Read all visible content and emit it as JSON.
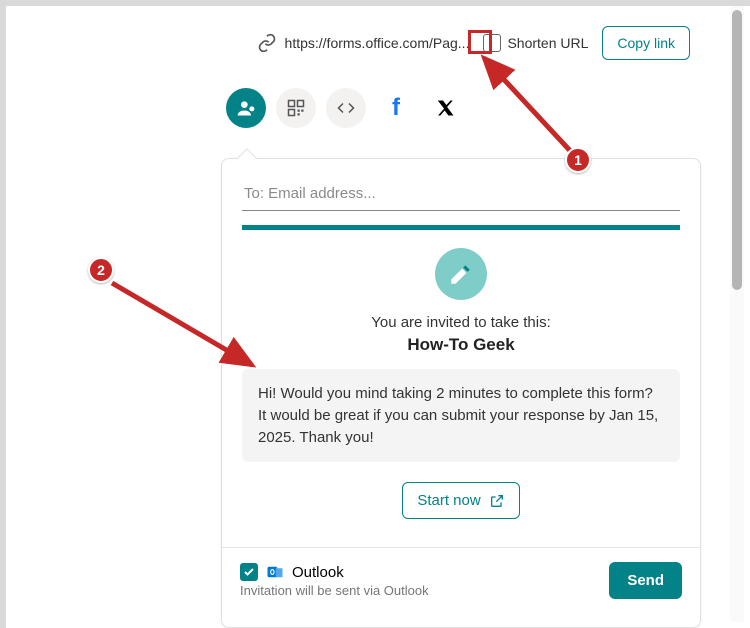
{
  "url_row": {
    "url_text": "https://forms.office.com/Pag...",
    "shorten_label": "Shorten URL",
    "copy_label": "Copy link"
  },
  "email_card": {
    "to_placeholder": "To: Email address...",
    "invite_text": "You are invited to take this:",
    "form_title": "How-To Geek",
    "message": "Hi! Would you mind taking 2 minutes to complete this form? It would be great if you can submit your response by Jan 15, 2025. Thank you!",
    "start_label": "Start now"
  },
  "footer": {
    "outlook_label": "Outlook",
    "subtext": "Invitation will be sent via Outlook",
    "send_label": "Send"
  },
  "annotations": {
    "marker1": "1",
    "marker2": "2"
  }
}
